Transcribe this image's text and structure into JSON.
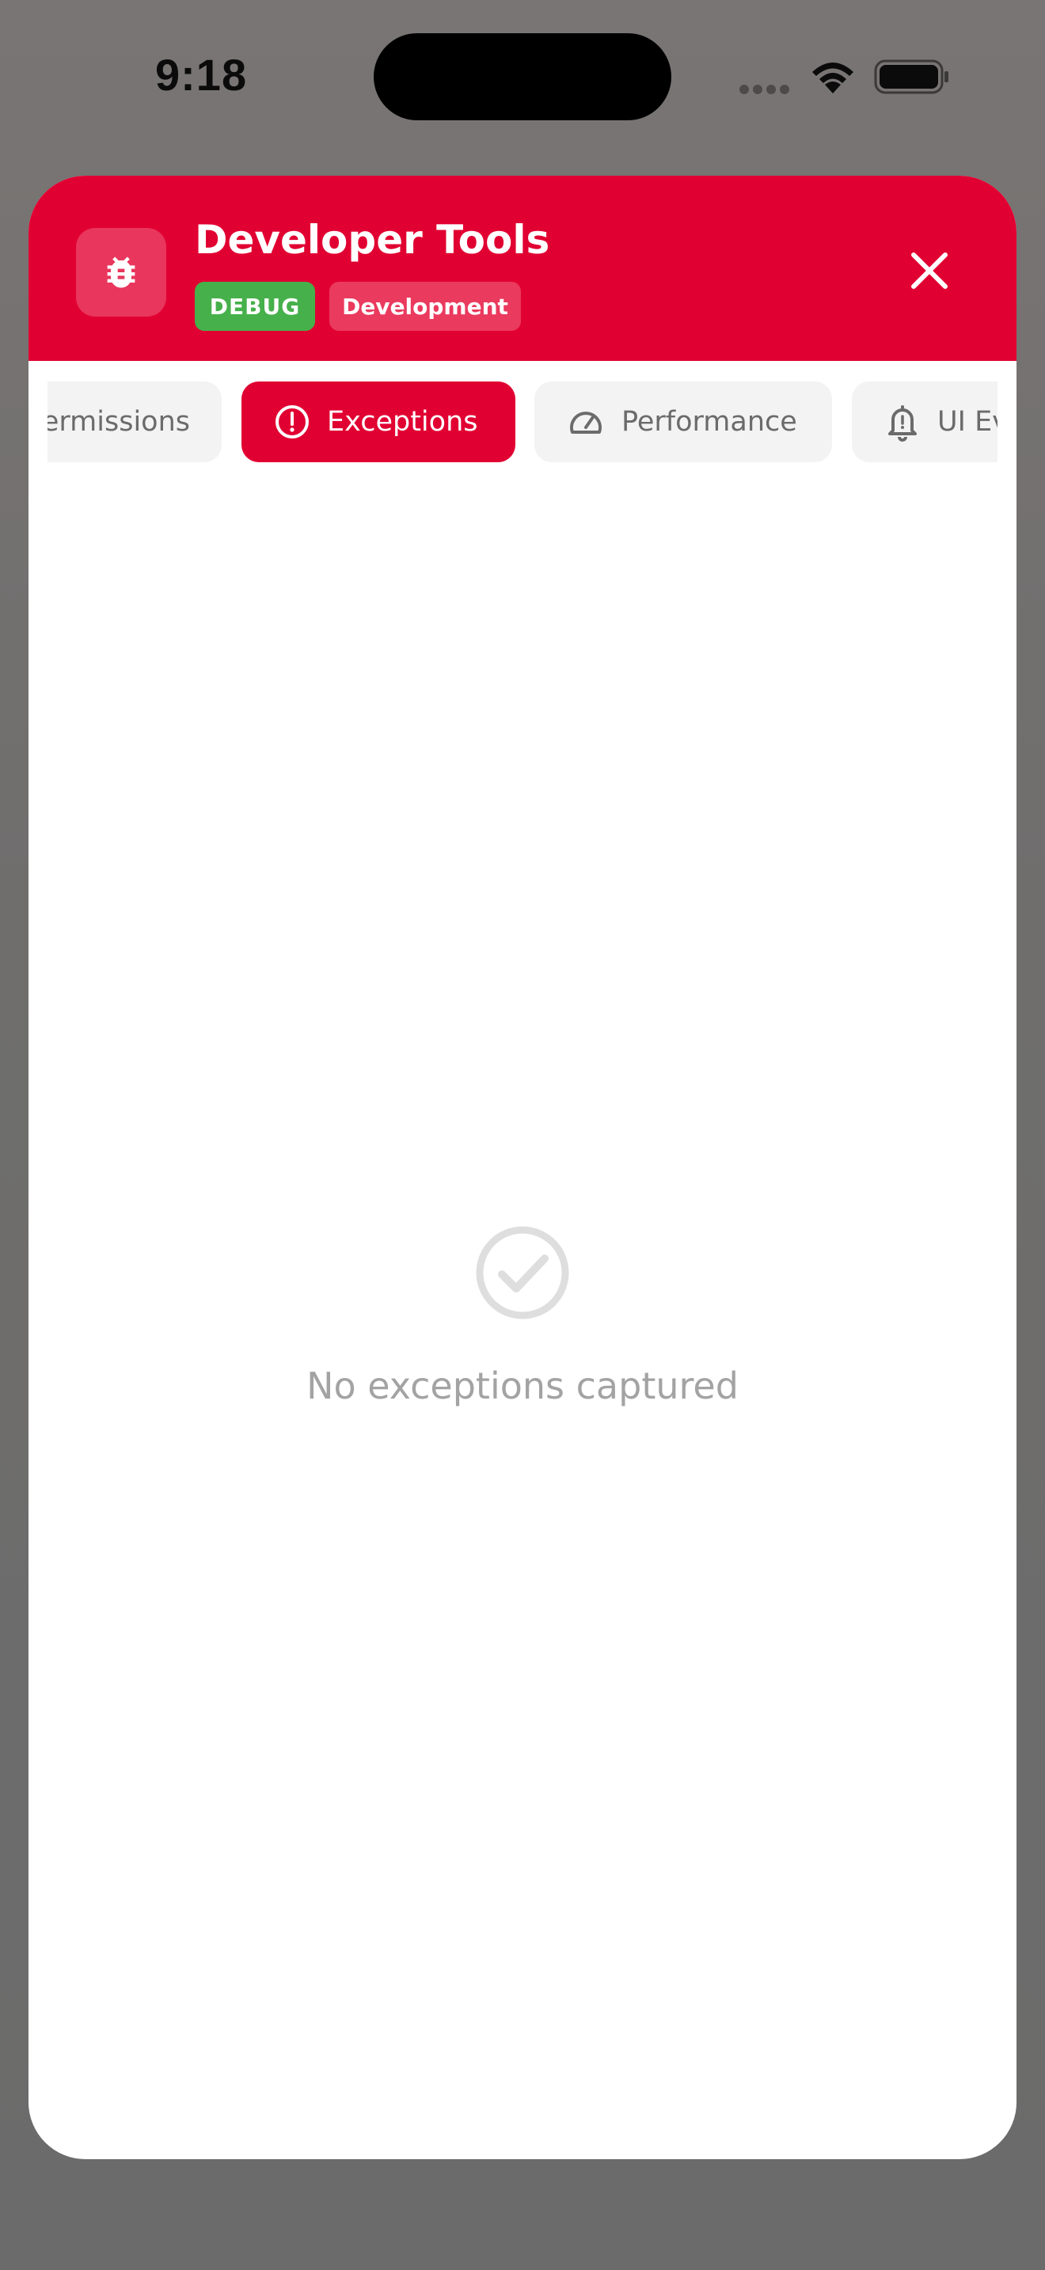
{
  "status_bar": {
    "time": "9:18"
  },
  "header": {
    "title": "Developer Tools",
    "badges": {
      "build": "DEBUG",
      "environment": "Development"
    },
    "colors": {
      "header_bg": "#e10032",
      "debug_badge": "#46b04b",
      "env_badge": "#ea3a5e"
    }
  },
  "tabs": [
    {
      "label": "Permissions",
      "icon": "permissions-icon",
      "active": false
    },
    {
      "label": "Exceptions",
      "icon": "alert-circle-icon",
      "active": true
    },
    {
      "label": "Performance",
      "icon": "gauge-icon",
      "active": false
    },
    {
      "label": "UI Events",
      "icon": "bell-icon",
      "active": false
    }
  ],
  "empty_state": {
    "icon": "check-circle-icon",
    "message": "No exceptions captured"
  }
}
